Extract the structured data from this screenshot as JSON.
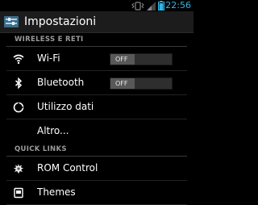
{
  "status_bar": {
    "time": "22:56",
    "icons": [
      "vibrate-icon",
      "mobile-signal-icon",
      "battery-icon"
    ]
  },
  "action_bar": {
    "icon": "settings-icon",
    "title": "Impostazioni"
  },
  "sections": [
    {
      "header": "WIRELESS E RETI",
      "items": [
        {
          "icon": "wifi-icon",
          "label": "Wi-Fi",
          "toggle": "OFF"
        },
        {
          "icon": "bluetooth-icon",
          "label": "Bluetooth",
          "toggle": "OFF"
        },
        {
          "icon": "data-usage-icon",
          "label": "Utilizzo dati"
        },
        {
          "icon": "",
          "label": "Altro..."
        }
      ]
    },
    {
      "header": "QUICK LINKS",
      "items": [
        {
          "icon": "rom-control-icon",
          "label": "ROM Control"
        },
        {
          "icon": "themes-icon",
          "label": "Themes"
        }
      ]
    }
  ],
  "colors": {
    "accent": "#33b5e5",
    "background": "#000000",
    "action_bar": "#1c1c1c"
  }
}
